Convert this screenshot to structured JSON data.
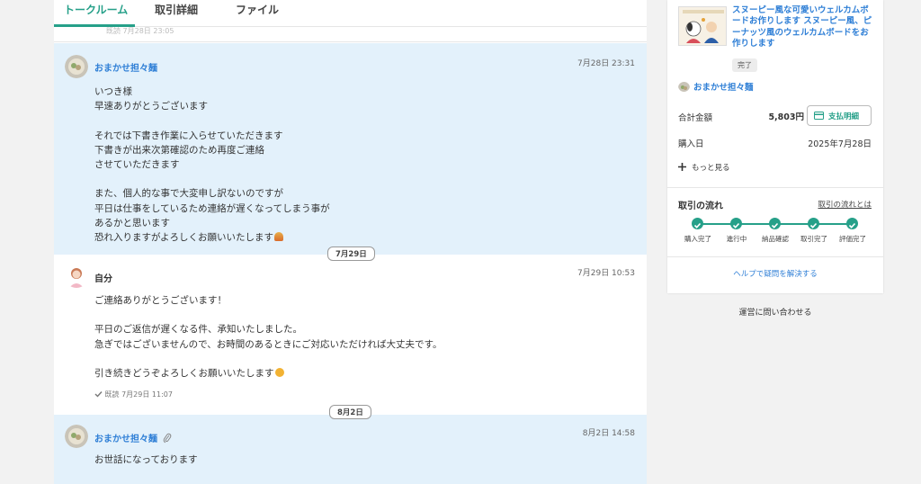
{
  "tabs": {
    "talk": "トークルーム",
    "details": "取引詳細",
    "files": "ファイル"
  },
  "previous": {
    "remnant": "既読 7月28日 23:05"
  },
  "messages": [
    {
      "sender": "おまかせ担々麺",
      "time": "7月28日 23:31",
      "lines": [
        "いつき様",
        "早速ありがとうございます",
        "",
        "それでは下書き作業に入らせていただきます",
        "下書きが出来次第確認のため再度ご連絡",
        "させていただきます",
        "",
        "また、個人的な事で大変申し訳ないのですが",
        "平日は仕事をしているため連絡が遅くなってしまう事が",
        "あるかと思います",
        "恐れ入りますがよろしくお願いいたします"
      ]
    },
    {
      "sender": "自分",
      "time": "7月29日 10:53",
      "lines": [
        "ご連絡ありがとうございます！",
        "",
        "平日のご返信が遅くなる件、承知いたしました。",
        "急ぎではございませんので、お時間のあるときにご対応いただければ大丈夫です。",
        "",
        "引き続きどうぞよろしくお願いいたします"
      ],
      "read": "既読 7月29日 11:07"
    },
    {
      "sender": "おまかせ担々麺",
      "time": "8月2日 14:58",
      "lines": [
        "お世話になっております"
      ]
    }
  ],
  "dates": {
    "d1": "7月29日",
    "d2": "8月2日"
  },
  "icons": {
    "check": "check-icon",
    "attachment": "paperclip-icon",
    "card": "credit-card-icon",
    "plus": "plus-icon",
    "emoji1": "bowing-emoji",
    "emoji2": "smiling-emoji"
  },
  "colors": {
    "accent": "#26a089",
    "link": "#2f7fd6",
    "bubble": "#e3f1fb"
  },
  "sidebar": {
    "product_title": "スヌーピー風な可愛いウェルカムボードお作りします スヌーピー風、ピーナッツ風のウェルカムボードをお作りします",
    "status": "完了",
    "seller": "おまかせ担々麺",
    "total_label": "合計金額",
    "total_value": "5,803円",
    "pay_button": "支払明細",
    "date_label": "購入日",
    "date_value": "2025年7月28日",
    "more": "もっと見る",
    "flow_title": "取引の流れ",
    "flow_link": "取引の流れとは",
    "flow_steps": [
      "購入完了",
      "進行中",
      "納品確認",
      "取引完了",
      "評価完了"
    ],
    "help": "ヘルプで疑問を解決する",
    "contact": "運営に問い合わせる"
  }
}
